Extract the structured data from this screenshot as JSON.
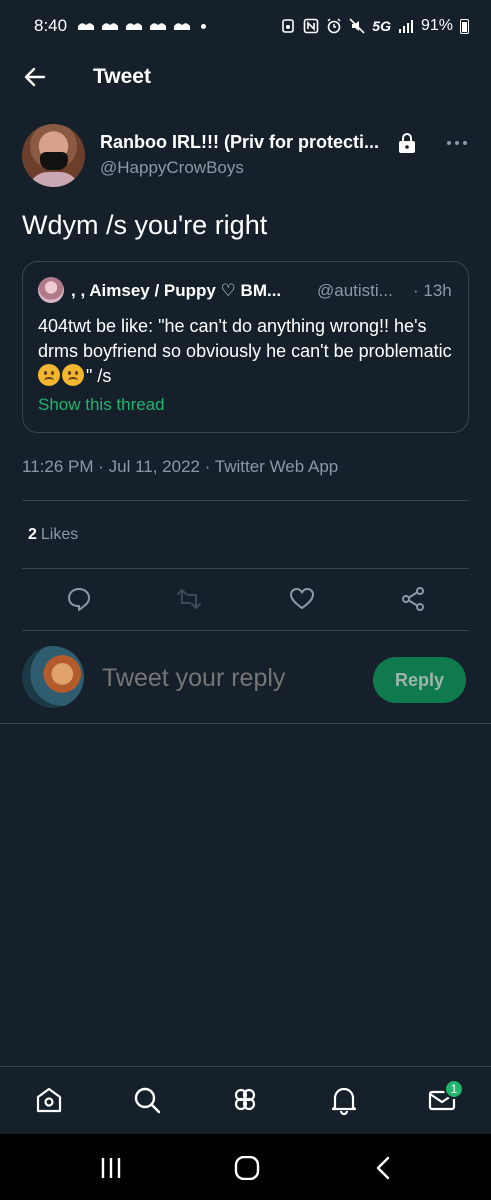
{
  "status_bar": {
    "time": "8:40",
    "network": "5G",
    "battery": "91%"
  },
  "header": {
    "title": "Tweet",
    "back_icon": "back-arrow-icon"
  },
  "tweet": {
    "display_name": "Ranboo IRL!!! (Priv for protecti...",
    "handle": "@HappyCrowBoys",
    "text": "Wdym /s you're right",
    "timestamp": "11:26 PM · Jul 11, 2022 · Twitter Web App",
    "likes_count": "2",
    "likes_label": "Likes"
  },
  "quoted_tweet": {
    "display_name": ", , Aimsey / Puppy ♡ BM...",
    "handle": "@autisti...",
    "time": "· 13h",
    "text_before_emoji": "404twt be like: \"he can't do anything wrong!! he's drms boyfriend so obviously he can't be problematic ",
    "text_after_emoji": "\" /s",
    "show_thread": "Show this thread"
  },
  "reply": {
    "placeholder": "Tweet your reply",
    "button_label": "Reply"
  },
  "tabbar": {
    "messages_badge": "1"
  },
  "colors": {
    "background": "#15202b",
    "accent": "#1fb56e",
    "secondary_text": "#8b98a5",
    "border": "#38444d"
  }
}
